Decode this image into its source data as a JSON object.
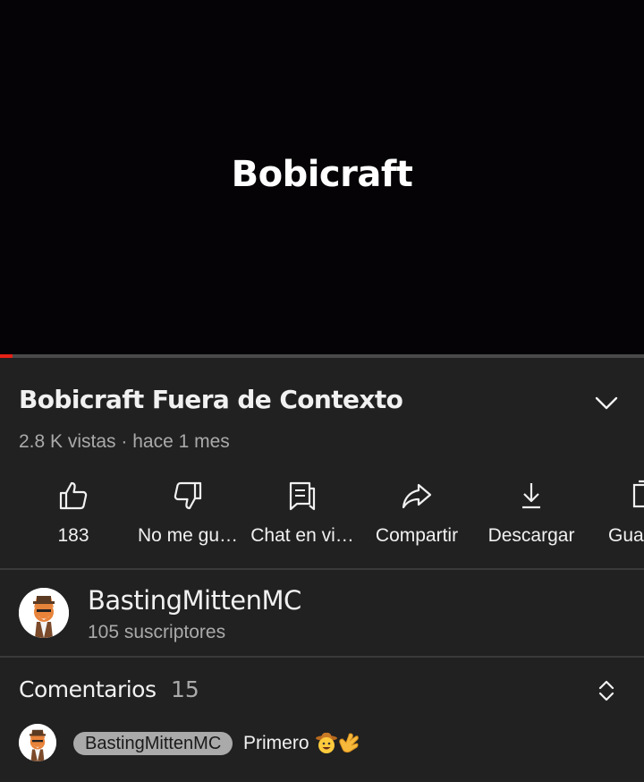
{
  "player": {
    "overlay_text": "Bobicraft",
    "progress_fraction": 0.02,
    "progress_color": "#e62117"
  },
  "video": {
    "title": "Bobicraft Fuera de Contexto",
    "views": "2.8 K vistas",
    "separator": "·",
    "published": "hace 1 mes",
    "expand_icon": "chevron-down-icon"
  },
  "actions": [
    {
      "label": "183",
      "icon": "thumbs-up-icon"
    },
    {
      "label": "No me gu…",
      "icon": "thumbs-down-icon"
    },
    {
      "label": "Chat en vi…",
      "icon": "live-chat-icon"
    },
    {
      "label": "Compartir",
      "icon": "share-icon"
    },
    {
      "label": "Descargar",
      "icon": "download-icon"
    },
    {
      "label": "Gua",
      "icon": "save-icon"
    }
  ],
  "channel": {
    "name": "BastingMittenMC",
    "subscribers": "105 suscriptores"
  },
  "comments": {
    "label": "Comentarios",
    "count": "15",
    "sort_icon": "expand-collapse-icon",
    "preview": {
      "author": "BastingMittenMC",
      "text": "Primero",
      "emojis": [
        "cowboy-face-emoji",
        "waving-hand-emoji"
      ]
    }
  }
}
